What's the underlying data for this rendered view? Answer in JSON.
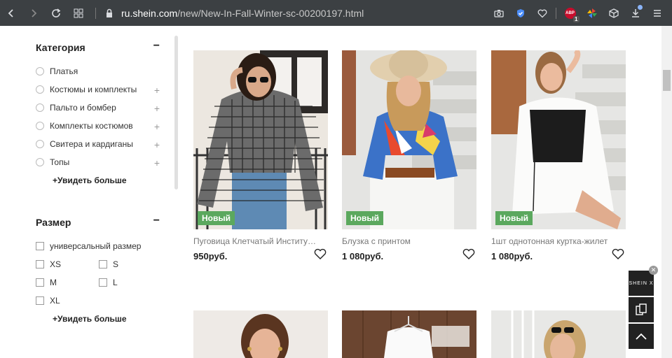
{
  "browser": {
    "url_host": "ru.shein.com",
    "url_path": "/new/New-In-Fall-Winter-sc-00200197.html",
    "abp_label": "ABP",
    "abp_count": "1"
  },
  "filters": {
    "category": {
      "title": "Категория",
      "toggle": "−",
      "items": [
        {
          "label": "Платья",
          "expandable": false
        },
        {
          "label": "Костюмы и комплекты",
          "expandable": true
        },
        {
          "label": "Пальто и бомбер",
          "expandable": true
        },
        {
          "label": "Комплекты костюмов",
          "expandable": true
        },
        {
          "label": "Свитера и кардиганы",
          "expandable": true
        },
        {
          "label": "Топы",
          "expandable": true
        }
      ],
      "more": "+Увидеть больше"
    },
    "size": {
      "title": "Размер",
      "toggle": "−",
      "universal": "универсальный размер",
      "options": [
        "XS",
        "S",
        "M",
        "L",
        "XL"
      ],
      "more": "+Увидеть больше"
    }
  },
  "products": [
    {
      "badge": "Новый",
      "name": "Пуговица Клетчатый Институтская блузка",
      "price": "950руб."
    },
    {
      "badge": "Новый",
      "name": "Блузка с принтом",
      "price": "1 080руб."
    },
    {
      "badge": "Новый",
      "name": "1шт однотонная куртка-жилет",
      "price": "1 080руб."
    }
  ],
  "float_widgets": {
    "brand_label": "SHEIN X"
  },
  "colors": {
    "badge": "#5ba85e",
    "toolbar": "#3c4043"
  }
}
